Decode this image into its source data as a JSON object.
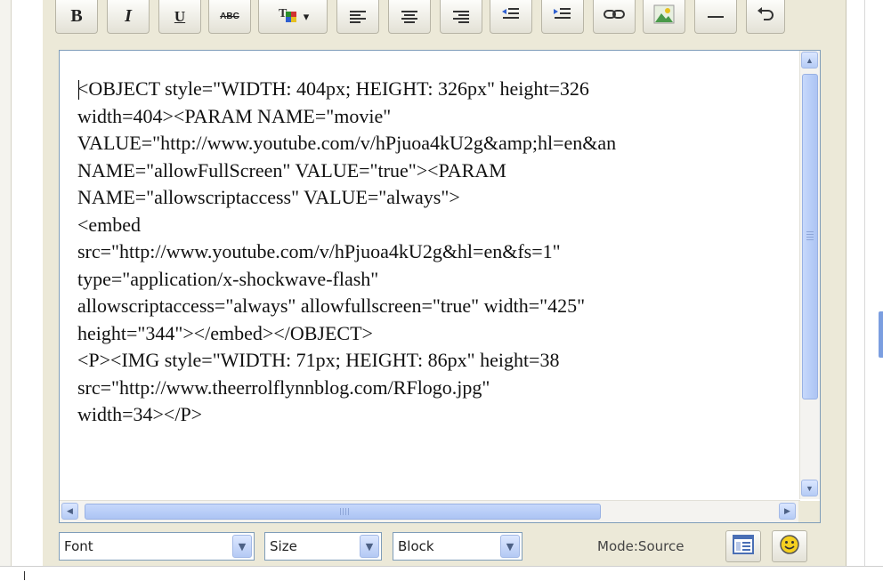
{
  "toolbar": {
    "bold": "B",
    "italic": "I",
    "underline": "U",
    "strikethrough": "ABC",
    "color_arrow": "▾"
  },
  "editor": {
    "source_lines": [
      "<OBJECT style=\"WIDTH: 404px; HEIGHT: 326px\" height=326",
      "width=404><PARAM NAME=\"movie\"",
      "VALUE=\"http://www.youtube.com/v/hPjuoa4kU2g&amp;hl=en&an",
      "NAME=\"allowFullScreen\" VALUE=\"true\"><PARAM",
      "NAME=\"allowscriptaccess\" VALUE=\"always\">",
      "<embed",
      "src=\"http://www.youtube.com/v/hPjuoa4kU2g&hl=en&fs=1\"",
      "type=\"application/x-shockwave-flash\"",
      "allowscriptaccess=\"always\" allowfullscreen=\"true\" width=\"425\"",
      "height=\"344\"></embed></OBJECT>",
      "<P><IMG style=\"WIDTH: 71px; HEIGHT: 86px\" height=38",
      "src=\"http://www.theerrolflynnblog.com/RFlogo.jpg\"",
      "width=34></P>"
    ]
  },
  "bottom_bar": {
    "font_select": "Font",
    "size_select": "Size",
    "block_select": "Block",
    "mode_label": "Mode:Source"
  },
  "icons": {
    "scroll_up": "▲",
    "scroll_down": "▼",
    "scroll_left": "◀",
    "scroll_right": "▶",
    "dropdown": "▼"
  }
}
